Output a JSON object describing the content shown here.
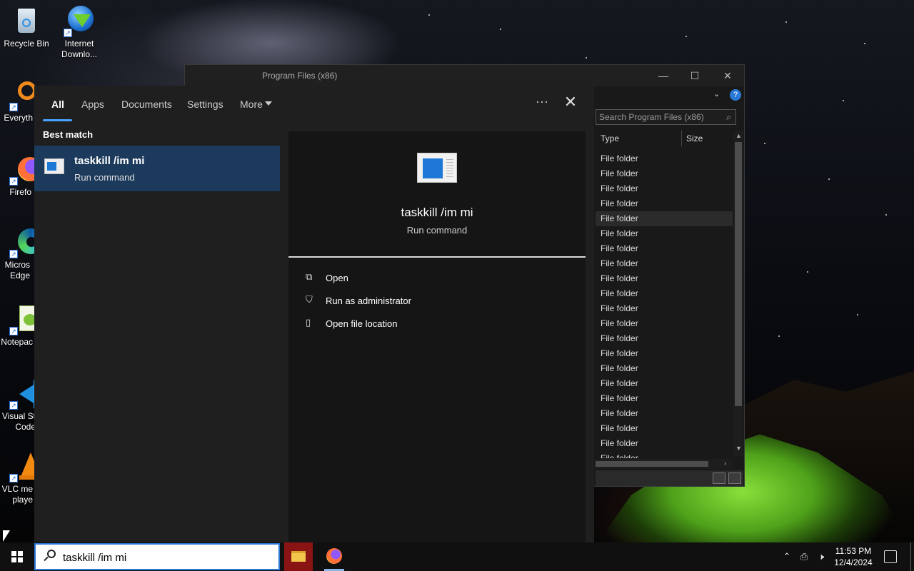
{
  "desktop": {
    "icons": [
      {
        "label": "Recycle Bin",
        "icon": "recycle-bin-icon"
      },
      {
        "label": "Internet\nDownlo...",
        "icon": "internet-download-manager-icon"
      },
      {
        "label": "Everyth",
        "icon": "everything-search-icon"
      },
      {
        "label": "Firefo",
        "icon": "firefox-icon"
      },
      {
        "label": "Micros\nEdge",
        "icon": "edge-icon"
      },
      {
        "label": "Notepac",
        "icon": "notepad-plus-plus-icon"
      },
      {
        "label": "Visual St\nCode",
        "icon": "vscode-icon"
      },
      {
        "label": "VLC me\nplaye",
        "icon": "vlc-icon"
      }
    ]
  },
  "explorer": {
    "title": "Program Files (x86)",
    "search_placeholder": "Search Program Files (x86)",
    "columns": [
      "Type",
      "Size"
    ],
    "rows": [
      "File folder",
      "File folder",
      "File folder",
      "File folder",
      "File folder",
      "File folder",
      "File folder",
      "File folder",
      "File folder",
      "File folder",
      "File folder",
      "File folder",
      "File folder",
      "File folder",
      "File folder",
      "File folder",
      "File folder",
      "File folder",
      "File folder",
      "File folder",
      "File folder"
    ],
    "highlighted_row": 4
  },
  "search_panel": {
    "tabs": [
      "All",
      "Apps",
      "Documents",
      "Settings",
      "More"
    ],
    "active_tab": "All",
    "options_label": "···",
    "close_label": "✕",
    "best_match_label": "Best match",
    "result": {
      "title": "taskkill /im mi",
      "subtitle": "Run command"
    },
    "detail": {
      "title": "taskkill /im mi",
      "subtitle": "Run command"
    },
    "actions": [
      {
        "label": "Open",
        "icon": "open-icon"
      },
      {
        "label": "Run as administrator",
        "icon": "shield-icon"
      },
      {
        "label": "Open file location",
        "icon": "file-location-icon"
      }
    ]
  },
  "taskbar": {
    "search_value": "taskkill /im mi",
    "time": "11:53 PM",
    "date": "12/4/2024"
  },
  "colors": {
    "accent": "#2b78d8",
    "selected_result": "#1c3a5c",
    "tab_underline": "#4aa3ff"
  }
}
